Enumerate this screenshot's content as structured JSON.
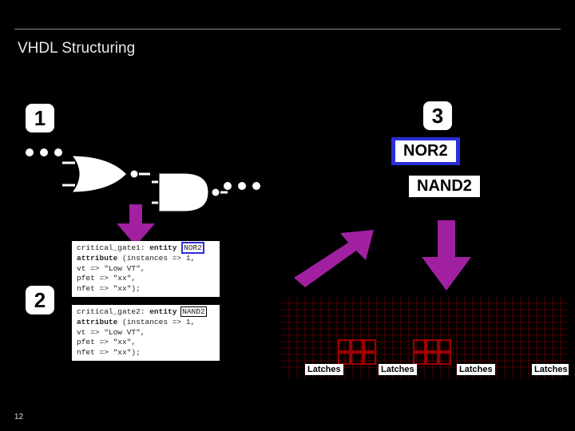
{
  "title": "VHDL Structuring",
  "page_number": "12",
  "badges": {
    "b1": "1",
    "b2": "2",
    "b3": "3"
  },
  "gate_labels": {
    "nor": "NOR2",
    "nand": "NAND2"
  },
  "code1": {
    "l1a": "critical_gate1: ",
    "l1b": "entity",
    "l1c": " ",
    "l1d": "NOR2",
    "l2a": "  ",
    "l2b": "attribute",
    "l2c": " (instances => 1,",
    "l3": "             vt => \"Low VT\",",
    "l4": "             pfet => \"xx\",",
    "l5": "             nfet => \"xx\");"
  },
  "code2": {
    "l1a": "critical_gate2: ",
    "l1b": "entity",
    "l1c": " ",
    "l1d": "NAND2",
    "l2a": "  ",
    "l2b": "attribute",
    "l2c": " (instances => 1,",
    "l3": "             vt => \"Low VT\",",
    "l4": "             pfet => \"xx\",",
    "l5": "             nfet => \"xx\");"
  },
  "latch_label": "Latches"
}
